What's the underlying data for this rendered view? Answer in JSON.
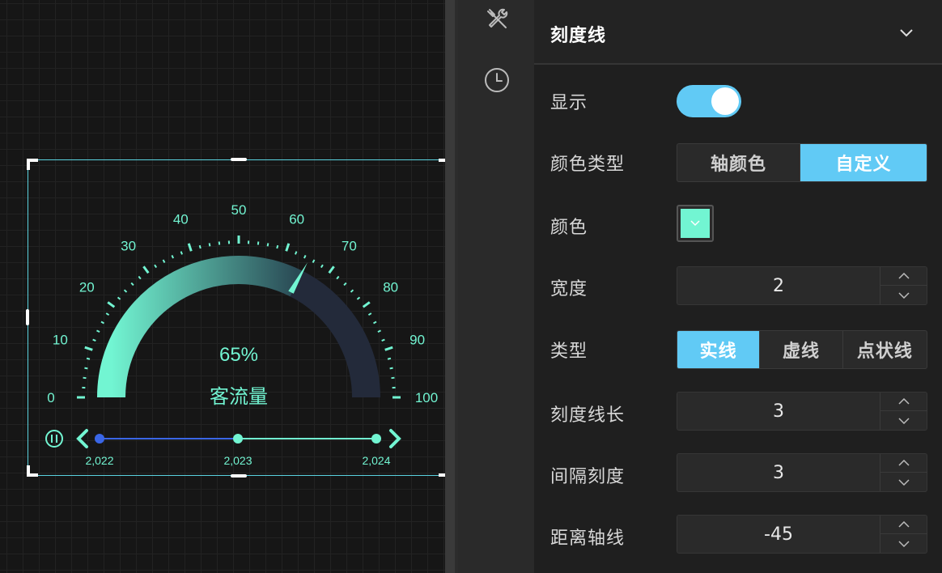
{
  "gauge": {
    "value_text": "65%",
    "label": "客流量",
    "value": 65,
    "min": 0,
    "max": 100,
    "tick_labels": [
      "0",
      "10",
      "20",
      "30",
      "40",
      "50",
      "60",
      "70",
      "80",
      "90",
      "100"
    ],
    "colors": {
      "accent": "#72f5d2",
      "track": "#232a3a",
      "text": "#72f5d2"
    }
  },
  "timeline": {
    "years": [
      "2,022",
      "2,023",
      "2,024"
    ],
    "active_index": 0,
    "colors": {
      "active": "#3a66e6",
      "line": "#72f5d2"
    }
  },
  "rail": {
    "icons": [
      "tools-icon",
      "clock-icon"
    ]
  },
  "panel": {
    "title": "刻度线",
    "rows": {
      "show": {
        "label": "显示",
        "enabled": true
      },
      "color_type": {
        "label": "颜色类型",
        "options": [
          "轴颜色",
          "自定义"
        ],
        "selected": "自定义"
      },
      "color": {
        "label": "颜色",
        "value": "#72f5d2"
      },
      "width": {
        "label": "宽度",
        "value": "2"
      },
      "line_type": {
        "label": "类型",
        "options": [
          "实线",
          "虚线",
          "点状线"
        ],
        "selected": "实线"
      },
      "tick_length": {
        "label": "刻度线长",
        "value": "3"
      },
      "interval": {
        "label": "间隔刻度",
        "value": "3"
      },
      "axis_distance": {
        "label": "距离轴线",
        "value": "-45"
      }
    }
  }
}
